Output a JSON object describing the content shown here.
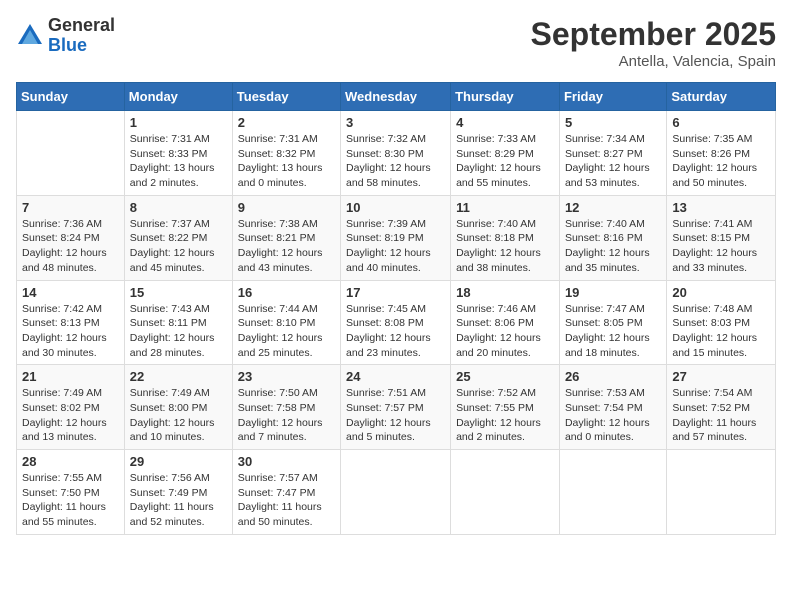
{
  "logo": {
    "general": "General",
    "blue": "Blue"
  },
  "header": {
    "month": "September 2025",
    "location": "Antella, Valencia, Spain"
  },
  "days_of_week": [
    "Sunday",
    "Monday",
    "Tuesday",
    "Wednesday",
    "Thursday",
    "Friday",
    "Saturday"
  ],
  "weeks": [
    [
      {
        "day": "",
        "info": ""
      },
      {
        "day": "1",
        "info": "Sunrise: 7:31 AM\nSunset: 8:33 PM\nDaylight: 13 hours\nand 2 minutes."
      },
      {
        "day": "2",
        "info": "Sunrise: 7:31 AM\nSunset: 8:32 PM\nDaylight: 13 hours\nand 0 minutes."
      },
      {
        "day": "3",
        "info": "Sunrise: 7:32 AM\nSunset: 8:30 PM\nDaylight: 12 hours\nand 58 minutes."
      },
      {
        "day": "4",
        "info": "Sunrise: 7:33 AM\nSunset: 8:29 PM\nDaylight: 12 hours\nand 55 minutes."
      },
      {
        "day": "5",
        "info": "Sunrise: 7:34 AM\nSunset: 8:27 PM\nDaylight: 12 hours\nand 53 minutes."
      },
      {
        "day": "6",
        "info": "Sunrise: 7:35 AM\nSunset: 8:26 PM\nDaylight: 12 hours\nand 50 minutes."
      }
    ],
    [
      {
        "day": "7",
        "info": "Sunrise: 7:36 AM\nSunset: 8:24 PM\nDaylight: 12 hours\nand 48 minutes."
      },
      {
        "day": "8",
        "info": "Sunrise: 7:37 AM\nSunset: 8:22 PM\nDaylight: 12 hours\nand 45 minutes."
      },
      {
        "day": "9",
        "info": "Sunrise: 7:38 AM\nSunset: 8:21 PM\nDaylight: 12 hours\nand 43 minutes."
      },
      {
        "day": "10",
        "info": "Sunrise: 7:39 AM\nSunset: 8:19 PM\nDaylight: 12 hours\nand 40 minutes."
      },
      {
        "day": "11",
        "info": "Sunrise: 7:40 AM\nSunset: 8:18 PM\nDaylight: 12 hours\nand 38 minutes."
      },
      {
        "day": "12",
        "info": "Sunrise: 7:40 AM\nSunset: 8:16 PM\nDaylight: 12 hours\nand 35 minutes."
      },
      {
        "day": "13",
        "info": "Sunrise: 7:41 AM\nSunset: 8:15 PM\nDaylight: 12 hours\nand 33 minutes."
      }
    ],
    [
      {
        "day": "14",
        "info": "Sunrise: 7:42 AM\nSunset: 8:13 PM\nDaylight: 12 hours\nand 30 minutes."
      },
      {
        "day": "15",
        "info": "Sunrise: 7:43 AM\nSunset: 8:11 PM\nDaylight: 12 hours\nand 28 minutes."
      },
      {
        "day": "16",
        "info": "Sunrise: 7:44 AM\nSunset: 8:10 PM\nDaylight: 12 hours\nand 25 minutes."
      },
      {
        "day": "17",
        "info": "Sunrise: 7:45 AM\nSunset: 8:08 PM\nDaylight: 12 hours\nand 23 minutes."
      },
      {
        "day": "18",
        "info": "Sunrise: 7:46 AM\nSunset: 8:06 PM\nDaylight: 12 hours\nand 20 minutes."
      },
      {
        "day": "19",
        "info": "Sunrise: 7:47 AM\nSunset: 8:05 PM\nDaylight: 12 hours\nand 18 minutes."
      },
      {
        "day": "20",
        "info": "Sunrise: 7:48 AM\nSunset: 8:03 PM\nDaylight: 12 hours\nand 15 minutes."
      }
    ],
    [
      {
        "day": "21",
        "info": "Sunrise: 7:49 AM\nSunset: 8:02 PM\nDaylight: 12 hours\nand 13 minutes."
      },
      {
        "day": "22",
        "info": "Sunrise: 7:49 AM\nSunset: 8:00 PM\nDaylight: 12 hours\nand 10 minutes."
      },
      {
        "day": "23",
        "info": "Sunrise: 7:50 AM\nSunset: 7:58 PM\nDaylight: 12 hours\nand 7 minutes."
      },
      {
        "day": "24",
        "info": "Sunrise: 7:51 AM\nSunset: 7:57 PM\nDaylight: 12 hours\nand 5 minutes."
      },
      {
        "day": "25",
        "info": "Sunrise: 7:52 AM\nSunset: 7:55 PM\nDaylight: 12 hours\nand 2 minutes."
      },
      {
        "day": "26",
        "info": "Sunrise: 7:53 AM\nSunset: 7:54 PM\nDaylight: 12 hours\nand 0 minutes."
      },
      {
        "day": "27",
        "info": "Sunrise: 7:54 AM\nSunset: 7:52 PM\nDaylight: 11 hours\nand 57 minutes."
      }
    ],
    [
      {
        "day": "28",
        "info": "Sunrise: 7:55 AM\nSunset: 7:50 PM\nDaylight: 11 hours\nand 55 minutes."
      },
      {
        "day": "29",
        "info": "Sunrise: 7:56 AM\nSunset: 7:49 PM\nDaylight: 11 hours\nand 52 minutes."
      },
      {
        "day": "30",
        "info": "Sunrise: 7:57 AM\nSunset: 7:47 PM\nDaylight: 11 hours\nand 50 minutes."
      },
      {
        "day": "",
        "info": ""
      },
      {
        "day": "",
        "info": ""
      },
      {
        "day": "",
        "info": ""
      },
      {
        "day": "",
        "info": ""
      }
    ]
  ]
}
